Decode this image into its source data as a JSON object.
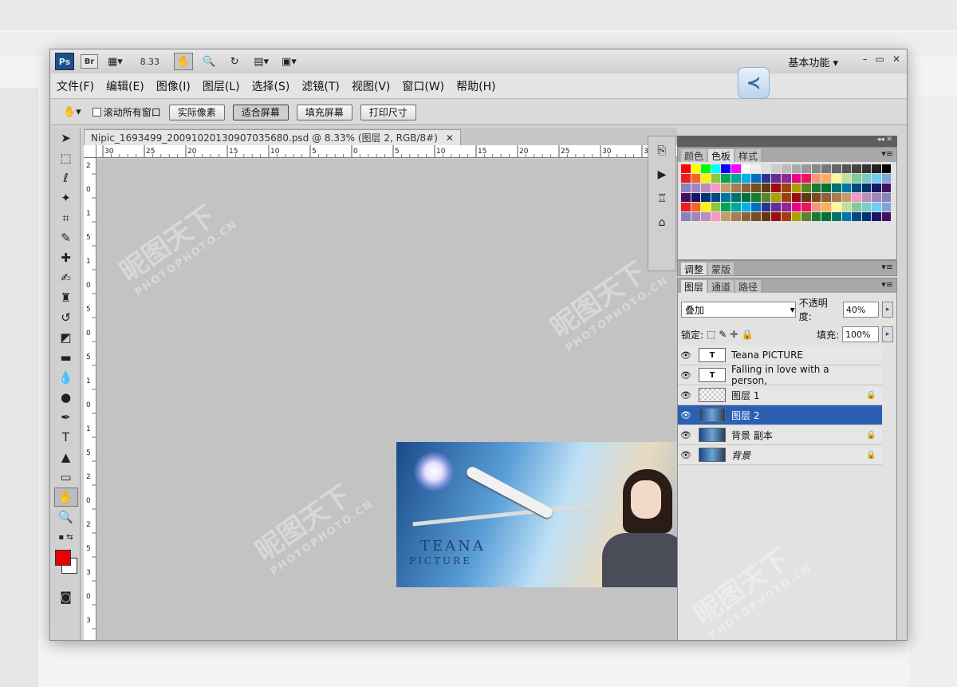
{
  "app": {
    "ps_logo": "Ps",
    "br_logo": "Br",
    "zoom": "8.33",
    "workspace": "基本功能",
    "win_min": "–",
    "win_restore": "▭",
    "win_close": "✕"
  },
  "menu": [
    "文件(F)",
    "编辑(E)",
    "图像(I)",
    "图层(L)",
    "选择(S)",
    "滤镜(T)",
    "视图(V)",
    "窗口(W)",
    "帮助(H)"
  ],
  "options": {
    "scroll_all": "滚动所有窗口",
    "actual_pixels": "实际像素",
    "fit_screen": "适合屏幕",
    "fill_screen": "填充屏幕",
    "print_size": "打印尺寸"
  },
  "document": {
    "tab_title": "Nipic_1693499_20091020130907035680.psd @ 8.33% (图层 2, RGB/8#)",
    "tab_close": "✕",
    "ruler_h": [
      "30",
      "25",
      "20",
      "15",
      "10",
      "5",
      "0",
      "5",
      "10",
      "15",
      "20",
      "25",
      "30",
      "3"
    ],
    "ruler_v": [
      "2",
      "0",
      "1",
      "5",
      "1",
      "0",
      "5",
      "0",
      "5",
      "1",
      "0",
      "1",
      "5",
      "2",
      "0",
      "2",
      "5",
      "3",
      "0",
      "3"
    ],
    "image_text_1": "TEANA",
    "image_text_2": "PICTURE"
  },
  "panels": {
    "top_tabs": [
      "颜色",
      "色板",
      "样式"
    ],
    "adjust_tabs": [
      "调整",
      "蒙版"
    ],
    "layer_tabs": [
      "图层",
      "通道",
      "路径"
    ],
    "blend_mode": "叠加",
    "opacity_label": "不透明度:",
    "opacity_value": "40%",
    "lock_label": "锁定:",
    "fill_label": "填充:",
    "fill_value": "100%",
    "layers": [
      {
        "name": "Teana  PICTURE",
        "type": "text",
        "thumb_label": "T"
      },
      {
        "name": "Falling in love with a person,",
        "type": "text",
        "thumb_label": "T"
      },
      {
        "name": "图层 1",
        "type": "transparent",
        "thumb_label": ""
      },
      {
        "name": "图层 2",
        "type": "image",
        "thumb_label": ""
      },
      {
        "name": "背景 副本",
        "type": "image",
        "thumb_label": ""
      },
      {
        "name": "背景",
        "type": "image",
        "thumb_label": ""
      }
    ]
  },
  "colors": {
    "foreground": "#e60000",
    "background": "#ffffff",
    "selection": "#2b5fb3"
  }
}
